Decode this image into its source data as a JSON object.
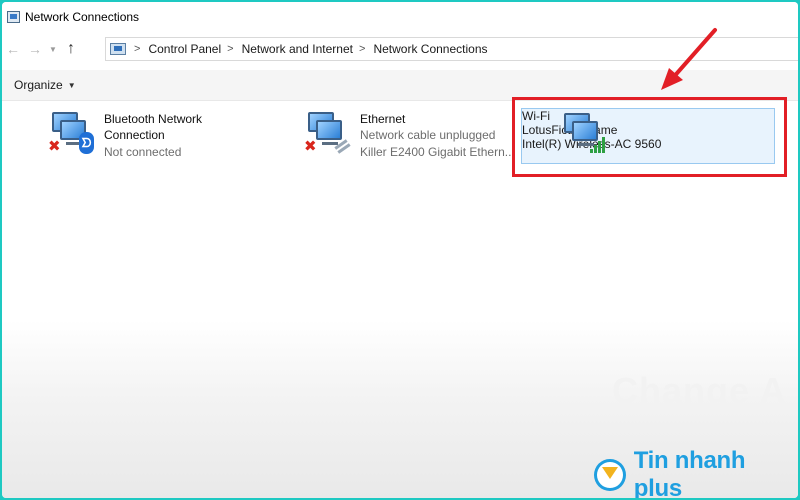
{
  "window": {
    "title": "Network Connections"
  },
  "breadcrumb": [
    "Control Panel",
    "Network and Internet",
    "Network Connections"
  ],
  "toolbar": {
    "organize_label": "Organize"
  },
  "connections": [
    {
      "name_line1": "Bluetooth Network",
      "name_line2": "Connection",
      "status": "Not connected",
      "icon": "bluetooth-icon",
      "state_icon": "disconnected-x-icon"
    },
    {
      "name": "Ethernet",
      "status": "Network cable unplugged",
      "device": "Killer E2400 Gigabit Ethern...",
      "icon": "ethernet-cable-icon",
      "state_icon": "disconnected-x-icon"
    },
    {
      "name": "Wi-Fi",
      "network": "LotusFictionFame",
      "device": "Intel(R) Wireless-AC 9560",
      "icon": "wifi-signal-icon",
      "selected": true
    }
  ],
  "annotation": {
    "highlight_color": "#e21f26",
    "arrow": "red-arrow"
  },
  "watermark": {
    "text": "Change A"
  },
  "brand": {
    "text": "Tin nhanh plus",
    "color": "#1f9fe0"
  }
}
